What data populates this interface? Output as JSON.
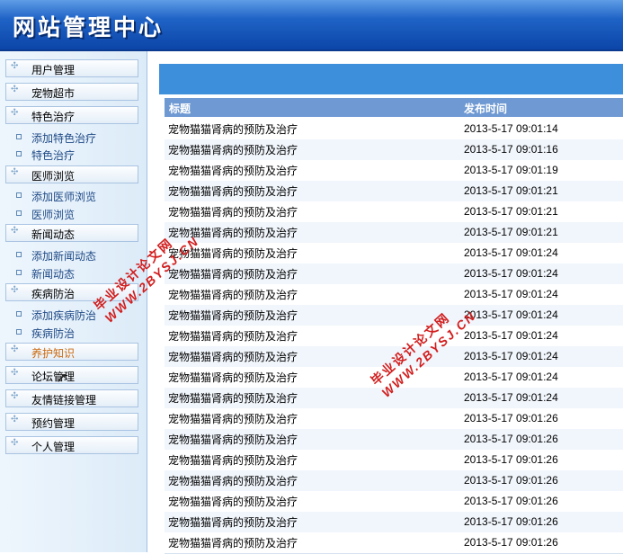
{
  "header": {
    "title": "网站管理中心"
  },
  "sidebar": {
    "menus": [
      {
        "label": "用户管理"
      },
      {
        "label": "宠物超市"
      },
      {
        "label": "特色治疗"
      },
      {
        "label": "医师浏览"
      },
      {
        "label": "新闻动态"
      },
      {
        "label": "疾病防治"
      },
      {
        "label": "养护知识"
      },
      {
        "label": "论坛管理"
      },
      {
        "label": "友情链接管理"
      },
      {
        "label": "预约管理"
      },
      {
        "label": "个人管理"
      }
    ],
    "subitems": [
      {
        "label": "添加特色治疗"
      },
      {
        "label": "特色治疗"
      },
      {
        "label": "添加医师浏览"
      },
      {
        "label": "医师浏览"
      },
      {
        "label": "添加新闻动态"
      },
      {
        "label": "新闻动态"
      },
      {
        "label": "添加疾病防治"
      },
      {
        "label": "疾病防治"
      }
    ]
  },
  "table": {
    "col_title": "标题",
    "col_date": "发布时间",
    "rows": [
      {
        "title": "宠物猫猫肾病的预防及治疗",
        "date": "2013-5-17 09:01:14"
      },
      {
        "title": "宠物猫猫肾病的预防及治疗",
        "date": "2013-5-17 09:01:16"
      },
      {
        "title": "宠物猫猫肾病的预防及治疗",
        "date": "2013-5-17 09:01:19"
      },
      {
        "title": "宠物猫猫肾病的预防及治疗",
        "date": "2013-5-17 09:01:21"
      },
      {
        "title": "宠物猫猫肾病的预防及治疗",
        "date": "2013-5-17 09:01:21"
      },
      {
        "title": "宠物猫猫肾病的预防及治疗",
        "date": "2013-5-17 09:01:21"
      },
      {
        "title": "宠物猫猫肾病的预防及治疗",
        "date": "2013-5-17 09:01:24"
      },
      {
        "title": "宠物猫猫肾病的预防及治疗",
        "date": "2013-5-17 09:01:24"
      },
      {
        "title": "宠物猫猫肾病的预防及治疗",
        "date": "2013-5-17 09:01:24"
      },
      {
        "title": "宠物猫猫肾病的预防及治疗",
        "date": "2013-5-17 09:01:24"
      },
      {
        "title": "宠物猫猫肾病的预防及治疗",
        "date": "2013-5-17 09:01:24"
      },
      {
        "title": "宠物猫猫肾病的预防及治疗",
        "date": "2013-5-17 09:01:24"
      },
      {
        "title": "宠物猫猫肾病的预防及治疗",
        "date": "2013-5-17 09:01:24"
      },
      {
        "title": "宠物猫猫肾病的预防及治疗",
        "date": "2013-5-17 09:01:24"
      },
      {
        "title": "宠物猫猫肾病的预防及治疗",
        "date": "2013-5-17 09:01:26"
      },
      {
        "title": "宠物猫猫肾病的预防及治疗",
        "date": "2013-5-17 09:01:26"
      },
      {
        "title": "宠物猫猫肾病的预防及治疗",
        "date": "2013-5-17 09:01:26"
      },
      {
        "title": "宠物猫猫肾病的预防及治疗",
        "date": "2013-5-17 09:01:26"
      },
      {
        "title": "宠物猫猫肾病的预防及治疗",
        "date": "2013-5-17 09:01:26"
      },
      {
        "title": "宠物猫猫肾病的预防及治疗",
        "date": "2013-5-17 09:01:26"
      },
      {
        "title": "宠物猫猫肾病的预防及治疗",
        "date": "2013-5-17 09:01:26"
      }
    ]
  },
  "watermark": {
    "name": "毕业设计论文网",
    "url": "WWW.2BYSJ.CN"
  }
}
